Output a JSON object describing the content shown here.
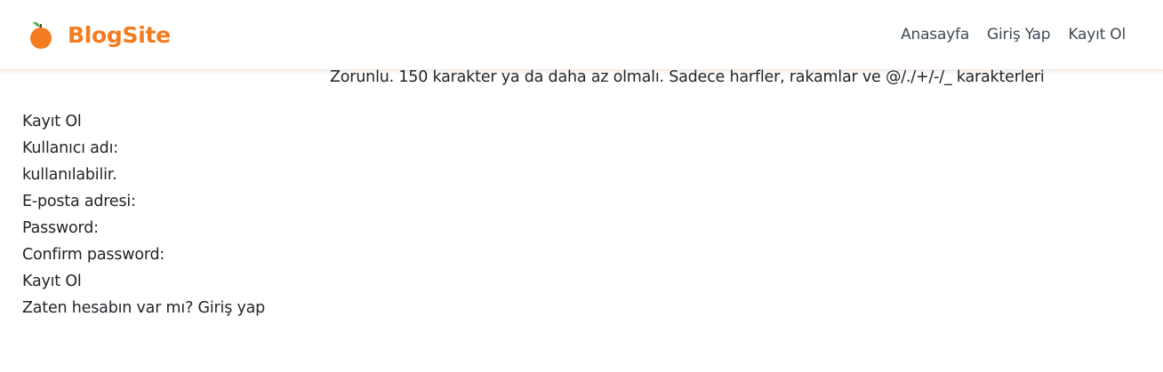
{
  "colors": {
    "brand": "#f47c20",
    "nav_text": "#3f4a56",
    "body_text": "#212529",
    "navbar_border": "#f7ebe5"
  },
  "header": {
    "brand_icon": "orange-icon",
    "brand_name": "BlogSite",
    "nav": [
      {
        "label": "Anasayfa"
      },
      {
        "label": "Giriş Yap"
      },
      {
        "label": "Kayıt Ol"
      }
    ]
  },
  "form": {
    "title": "Kayıt Ol",
    "username_label": "Kullanıcı adı:",
    "username_help": "Zorunlu. 150 karakter ya da daha az olmalı. Sadece harfler, rakamlar ve @/./+/-/_ karakterleri",
    "username_help_wrap": "kullanılabilir.",
    "email_label": "E-posta adresi:",
    "password_label": "Password:",
    "confirm_password_label": "Confirm password:",
    "submit_label": "Kayıt Ol",
    "login_prompt": "Zaten hesabın var mı? Giriş yap"
  }
}
